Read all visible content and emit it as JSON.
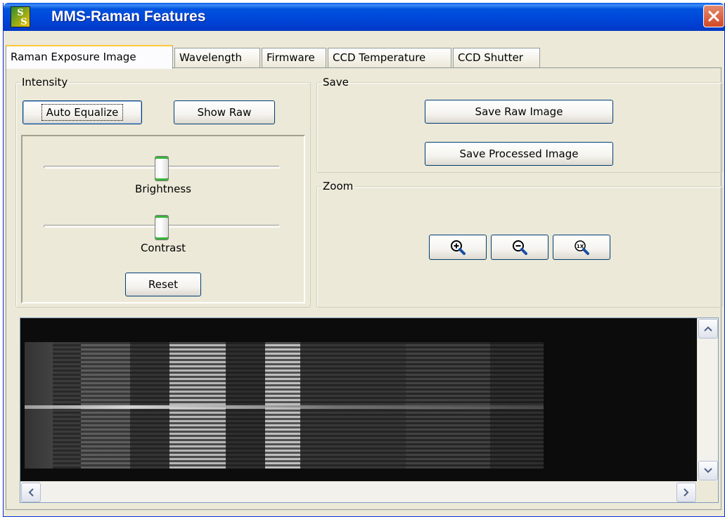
{
  "window": {
    "title": "MMS-Raman Features"
  },
  "tabs": [
    {
      "label": "Raman Exposure Image",
      "active": true
    },
    {
      "label": "Wavelength",
      "active": false
    },
    {
      "label": "Firmware",
      "active": false
    },
    {
      "label": "CCD Temperature",
      "active": false
    },
    {
      "label": "CCD Shutter",
      "active": false
    }
  ],
  "intensity": {
    "group_label": "Intensity",
    "auto_equalize_label": "Auto Equalize",
    "show_raw_label": "Show Raw",
    "brightness_label": "Brightness",
    "brightness_value": 0.5,
    "contrast_label": "Contrast",
    "contrast_value": 0.5,
    "reset_label": "Reset"
  },
  "save": {
    "group_label": "Save",
    "save_raw_label": "Save Raw Image",
    "save_processed_label": "Save Processed Image"
  },
  "zoom": {
    "group_label": "Zoom",
    "buttons": [
      "zoom-in-icon",
      "zoom-out-icon",
      "zoom-reset-1x-icon"
    ],
    "reset_glyph": "1X"
  },
  "colors": {
    "title_bar": "#0046d8",
    "window_bg": "#ece9d8",
    "active_tab_accent": "#ffc83c",
    "slider_thumb_accent": "#3ab33a",
    "image_bg": "#0c0c0c"
  }
}
